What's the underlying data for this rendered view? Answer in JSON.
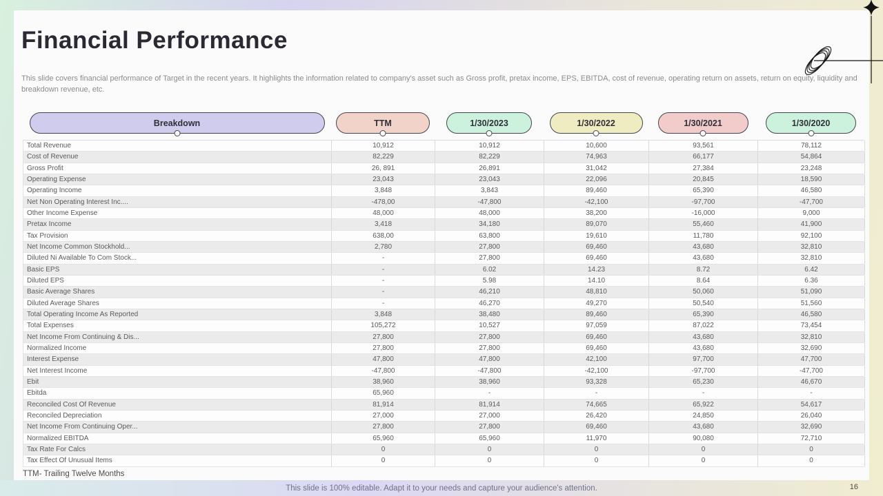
{
  "slide": {
    "title": "Financial Performance",
    "subtitle": "This slide covers financial performance of Target in the recent years. It highlights the information related to company's asset such as Gross profit, pretax income, EPS, EBITDA,  cost of revenue, operating return on assets, return on equity,  liquidity and breakdown revenue, etc.",
    "footnote": "TTM-  Trailing Twelve Months",
    "footer_note": "This slide is 100% editable. Adapt it to your needs and capture your audience's attention.",
    "page_number": "16"
  },
  "table": {
    "columns": [
      {
        "label": "Breakdown",
        "color": "#cfccee"
      },
      {
        "label": "TTM",
        "color": "#f2d3c9"
      },
      {
        "label": "1/30/2023",
        "color": "#ccf1dc"
      },
      {
        "label": "1/30/2022",
        "color": "#f0ecc2"
      },
      {
        "label": "1/30/2021",
        "color": "#f1cccb"
      },
      {
        "label": "1/30/2020",
        "color": "#ccf1dc"
      }
    ],
    "rows": [
      [
        "Total Revenue",
        "10,912",
        "10,912",
        "10,600",
        "93,561",
        "78,112"
      ],
      [
        "Cost of Revenue",
        "82,229",
        "82,229",
        "74,963",
        "66,177",
        "54,864"
      ],
      [
        "Gross Profit",
        "26, 891",
        "26,891",
        "31,042",
        "27,384",
        "23,248"
      ],
      [
        "Operating Expense",
        "23,043",
        "23,043",
        "22,096",
        "20,845",
        "18,590"
      ],
      [
        "Operating Income",
        "3,848",
        "3,843",
        "89,460",
        "65,390",
        "46,580"
      ],
      [
        "Net Non Operating Interest Inc....",
        "-478,00",
        "-47,800",
        "-42,100",
        "-97,700",
        "-47,700"
      ],
      [
        "Other Income Expense",
        "48,000",
        "48,000",
        "38,200",
        "-16,000",
        "9,000"
      ],
      [
        "Pretax Income",
        "3,418",
        "34,180",
        "89,070",
        "55,460",
        "41,900"
      ],
      [
        "Tax Provision",
        "638,00",
        "63,800",
        "19,610",
        "11,780",
        "92,100"
      ],
      [
        "Net Income Common  Stockhold...",
        "2,780",
        "27,800",
        "69,460",
        "43,680",
        "32,810"
      ],
      [
        "Diluted Ni Available To Com  Stock...",
        "-",
        "27,800",
        "69,460",
        "43,680",
        "32,810"
      ],
      [
        "Basic EPS",
        "-",
        "6.02",
        "14.23",
        "8.72",
        "6.42"
      ],
      [
        "Diluted EPS",
        "-",
        "5.98",
        "14.10",
        "8.64",
        "6.36"
      ],
      [
        "Basic Average Shares",
        "-",
        "46,210",
        "48,810",
        "50,060",
        "51,090"
      ],
      [
        "Diluted  Average Shares",
        "-",
        "46,270",
        "49,270",
        "50,540",
        "51,560"
      ],
      [
        "Total Operating Income  As Reported",
        "3,848",
        "38,480",
        "89,460",
        "65,390",
        "46,580"
      ],
      [
        "Total Expenses",
        "105,272",
        "10,527",
        "97,059",
        "87,022",
        "73,454"
      ],
      [
        "Net Income From Continuing & Dis...",
        "27,800",
        "27,800",
        "69,460",
        "43,680",
        "32,810"
      ],
      [
        "Normalized Income",
        "27,800",
        "27,800",
        "69,460",
        "43,680",
        "32,690"
      ],
      [
        "Interest Expense",
        "47,800",
        "47,800",
        "42,100",
        "97,700",
        "47,700"
      ],
      [
        "Net Interest Income",
        "-47,800",
        "-47,800",
        "-42,100",
        "-97,700",
        "-47,700"
      ],
      [
        "Ebit",
        "38,960",
        "38,960",
        "93,328",
        "65,230",
        "46,670"
      ],
      [
        "Ebitda",
        "65,960",
        "-",
        "-",
        "-",
        "-"
      ],
      [
        "Reconciled Cost Of Revenue",
        "81,914",
        "81,914",
        "74,665",
        "65,922",
        "54,617"
      ],
      [
        "Reconciled Depreciation",
        "27,000",
        "27,000",
        "26,420",
        "24,850",
        "26,040"
      ],
      [
        "Net Income From Continuing Oper...",
        "27,800",
        "27,800",
        "69,460",
        "43,680",
        "32,690"
      ],
      [
        "Normalized EBITDA",
        "65,960",
        "65,960",
        "11,970",
        "90,080",
        "72,710"
      ],
      [
        "Tax Rate For Calcs",
        "0",
        "0",
        "0",
        "0",
        "0"
      ],
      [
        "Tax Effect Of Unusual Items",
        "0",
        "0",
        "0",
        "0",
        "0"
      ]
    ]
  }
}
